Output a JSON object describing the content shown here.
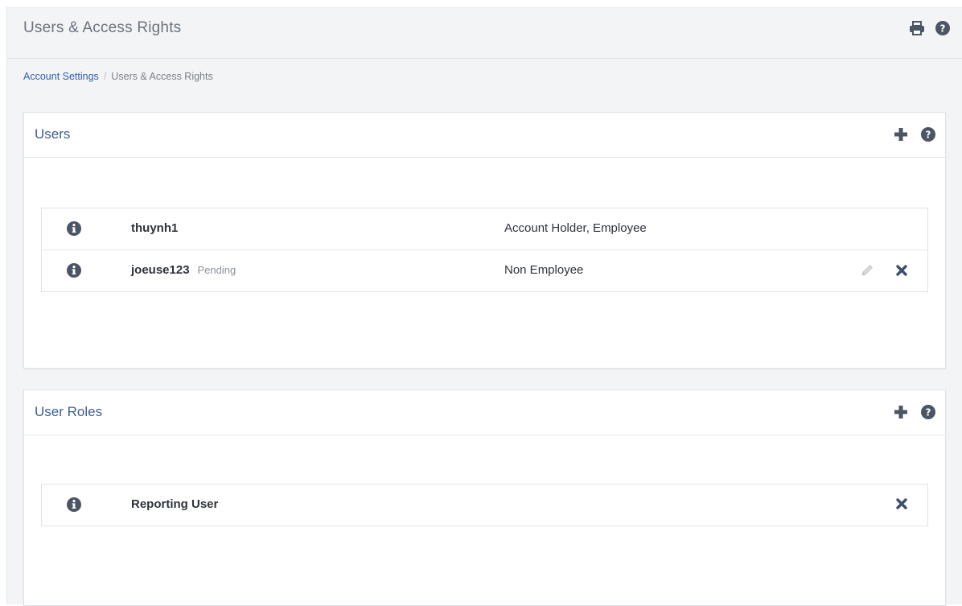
{
  "header": {
    "title": "Users & Access Rights",
    "icons": [
      "printer-icon",
      "help-icon"
    ]
  },
  "breadcrumb": {
    "link": "Account Settings",
    "separator": "/",
    "current": "Users & Access Rights"
  },
  "users_panel": {
    "title": "Users",
    "icons": [
      "plus-icon",
      "help-icon"
    ],
    "rows": [
      {
        "username": "thuynh1",
        "status": "",
        "roles": "Account Holder, Employee",
        "editable": false,
        "deletable": false
      },
      {
        "username": "joeuse123",
        "status": "Pending",
        "roles": "Non Employee",
        "editable": true,
        "deletable": true
      }
    ]
  },
  "roles_panel": {
    "title": "User Roles",
    "icons": [
      "plus-icon",
      "help-icon"
    ],
    "rows": [
      {
        "name": "Reporting User",
        "deletable": true
      }
    ]
  },
  "colors": {
    "panel_title": "#3f5f8f",
    "icon_dark": "#4b5566",
    "link": "#2f5fb0",
    "delete_icon": "#3c4e6e"
  }
}
